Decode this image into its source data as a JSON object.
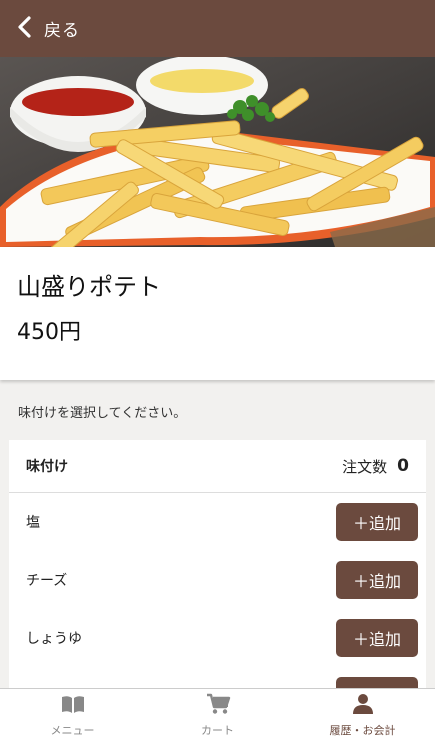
{
  "header": {
    "back_label": "戻る",
    "back_icon": "chevron-left-icon"
  },
  "product": {
    "name": "山盛りポテト",
    "price": "450円"
  },
  "instruction": "味付けを選択してください。",
  "options_panel": {
    "column_label": "味付け",
    "order_count_label": "注文数",
    "order_count_value": "0",
    "add_label": "＋追加",
    "items": [
      "塩",
      "チーズ",
      "しょうゆ"
    ]
  },
  "tabbar": {
    "tabs": [
      {
        "label": "メニュー",
        "icon": "book-icon"
      },
      {
        "label": "カート",
        "icon": "cart-icon"
      },
      {
        "label": "履歴・お会計",
        "icon": "user-icon"
      }
    ]
  },
  "colors": {
    "brand": "#6b4a3e",
    "background": "#f2f1ef"
  }
}
